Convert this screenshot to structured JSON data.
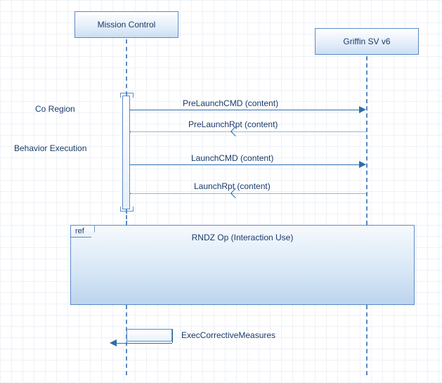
{
  "lifelines": {
    "missionControl": {
      "label": "Mission Control"
    },
    "griffin": {
      "label": "Griffin SV v6"
    }
  },
  "labels": {
    "coRegion": "Co Region",
    "behaviorExecution": "Behavior Execution"
  },
  "messages": {
    "preLaunchCmd": "PreLaunchCMD (content)",
    "preLaunchRpt": "PreLaunchRpt (content)",
    "launchCmd": "LaunchCMD (content)",
    "launchRpt": "LaunchRpt (content)",
    "execCorrective": "ExecCorrectiveMeasures"
  },
  "interactionUse": {
    "tag": "ref",
    "title": "RNDZ Op (Interaction Use)"
  },
  "chart_data": {
    "type": "sequence-diagram",
    "lifelines": [
      "Mission Control",
      "Griffin SV v6"
    ],
    "coRegion": {
      "on": "Mission Control",
      "covers": [
        "PreLaunchCMD (content)",
        "PreLaunchRpt (content)",
        "LaunchCMD (content)",
        "LaunchRpt (content)"
      ]
    },
    "behaviorExecution": {
      "on": "Mission Control"
    },
    "messages": [
      {
        "from": "Mission Control",
        "to": "Griffin SV v6",
        "label": "PreLaunchCMD (content)",
        "style": "sync"
      },
      {
        "from": "Griffin SV v6",
        "to": "Mission Control",
        "label": "PreLaunchRpt (content)",
        "style": "return"
      },
      {
        "from": "Mission Control",
        "to": "Griffin SV v6",
        "label": "LaunchCMD (content)",
        "style": "sync"
      },
      {
        "from": "Griffin SV v6",
        "to": "Mission Control",
        "label": "LaunchRpt (content)",
        "style": "return"
      },
      {
        "from": "Mission Control",
        "to": "Mission Control",
        "label": "ExecCorrectiveMeasures",
        "style": "self"
      }
    ],
    "interactionUse": {
      "label": "RNDZ Op (Interaction Use)",
      "tag": "ref",
      "spans": [
        "Mission Control",
        "Griffin SV v6"
      ]
    }
  }
}
